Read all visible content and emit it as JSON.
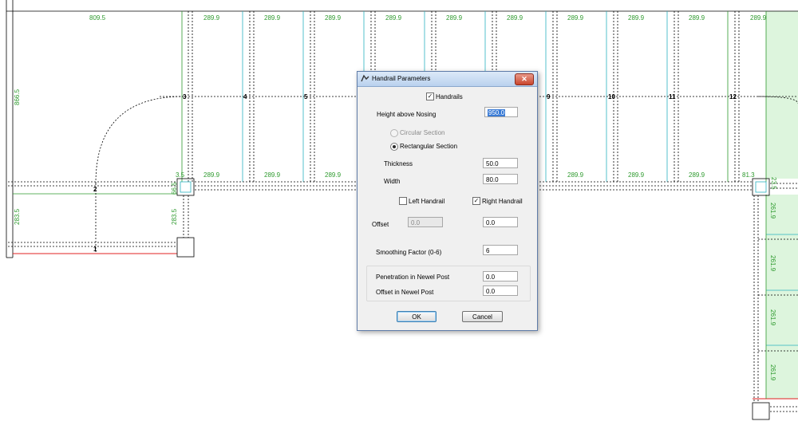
{
  "drawing": {
    "top_dims": [
      "809.5",
      "289.9",
      "289.9",
      "289.9",
      "289.9",
      "289.9",
      "289.9",
      "289.9",
      "289.9",
      "289.9",
      "289.9"
    ],
    "mid_dims": [
      "3.5",
      "289.9",
      "289.9",
      "289.9",
      "289.9",
      "289.9",
      "289.9",
      "81.3"
    ],
    "left_dims": [
      "866.5",
      "283.5",
      "283.5"
    ],
    "small_dims": [
      "66.5",
      "23.5"
    ],
    "right_dims": [
      "261.9",
      "261.9",
      "261.9",
      "261.9"
    ],
    "step_numbers": [
      "1",
      "2",
      "3",
      "4",
      "5",
      "9",
      "10",
      "11",
      "12"
    ]
  },
  "dialog": {
    "title": "Handrail Parameters",
    "close_label": "✕",
    "handrails_label": "Handrails",
    "handrails_checked": "✓",
    "height_label": "Height above Nosing",
    "height_value": "950.0",
    "circular_label": "Circular Section",
    "rectangular_label": "Rectangular Section",
    "thickness_label": "Thickness",
    "thickness_value": "50.0",
    "width_label": "Width",
    "width_value": "80.0",
    "left_handrail_label": "Left Handrail",
    "left_handrail_checked": "",
    "right_handrail_label": "Right Handrail",
    "right_handrail_checked": "✓",
    "offset_label": "Offset",
    "offset_left_value": "0.0",
    "offset_right_value": "0.0",
    "smoothing_label": "Smoothing Factor (0-6)",
    "smoothing_value": "6",
    "penetration_label": "Penetration in Newel Post",
    "penetration_value": "0.0",
    "offset_newel_label": "Offset in Newel Post",
    "offset_newel_value": "0.0",
    "ok_label": "OK",
    "cancel_label": "Cancel"
  }
}
